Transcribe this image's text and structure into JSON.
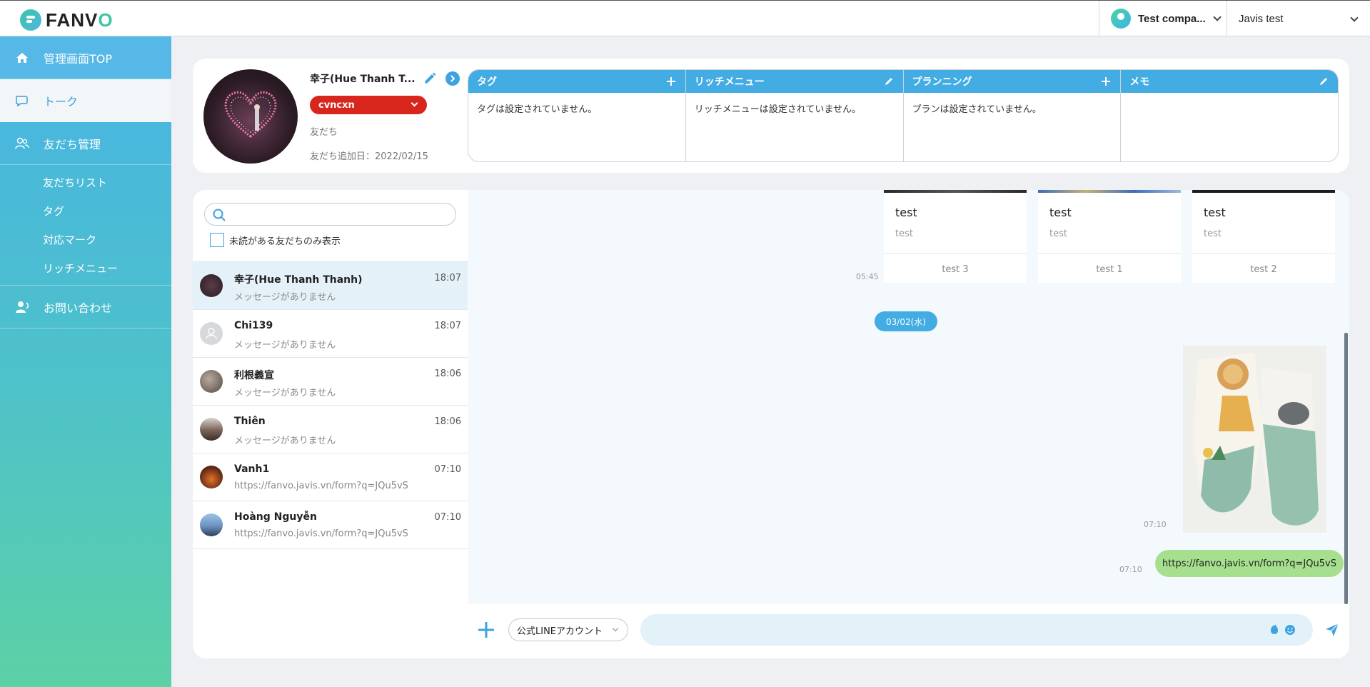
{
  "header": {
    "logo_text_prefix": "FANV",
    "logo_text_o": "O",
    "company_name": "Test compa...",
    "user_name": "Javis test"
  },
  "sidebar": {
    "items": [
      {
        "label": "管理画面TOP",
        "icon": "home-icon"
      },
      {
        "label": "トーク",
        "icon": "chat-icon"
      },
      {
        "label": "友だち管理",
        "icon": "friends-icon"
      },
      {
        "label": "お問い合わせ",
        "icon": "contact-icon"
      }
    ],
    "sub_items": [
      "友だちリスト",
      "タグ",
      "対応マーク",
      "リッチメニュー"
    ]
  },
  "profile": {
    "name": "幸子(Hue Thanh T...",
    "status_value": "cvncxn",
    "friend_label": "友だち",
    "friend_added": "友だち追加日：2022/02/15"
  },
  "panels": [
    {
      "title": "タグ",
      "action_icon": "plus-icon",
      "body": "タグは設定されていません。"
    },
    {
      "title": "リッチメニュー",
      "action_icon": "pencil-icon",
      "body": "リッチメニューは設定されていません。"
    },
    {
      "title": "プランニング",
      "action_icon": "plus-icon",
      "body": "プランは設定されていません。"
    },
    {
      "title": "メモ",
      "action_icon": "pencil-icon",
      "body": ""
    }
  ],
  "friend_list": {
    "search_placeholder": "",
    "unread_only_label": "未読がある友だちのみ表示",
    "rows": [
      {
        "name": "幸子(Hue Thanh Thanh)",
        "time": "18:07",
        "message": "メッセージがありません"
      },
      {
        "name": "Chi139",
        "time": "18:07",
        "message": "メッセージがありません"
      },
      {
        "name": "利根義宣",
        "time": "18:06",
        "message": "メッセージがありません"
      },
      {
        "name": "Thiên",
        "time": "18:06",
        "message": "メッセージがありません"
      },
      {
        "name": "Vanh1",
        "time": "07:10",
        "message": "https://fanvo.javis.vn/form?q=JQu5vS"
      },
      {
        "name": "Hoàng Nguyễn",
        "time": "07:10",
        "message": "https://fanvo.javis.vn/form?q=JQu5vS"
      }
    ]
  },
  "chat": {
    "carousel_time": "05:45",
    "cards": [
      {
        "title": "test",
        "subtitle": "test",
        "action": "test 3"
      },
      {
        "title": "test",
        "subtitle": "test",
        "action": "test 1"
      },
      {
        "title": "test",
        "subtitle": "test",
        "action": "test 2"
      }
    ],
    "date_chip": "03/02(水)",
    "image_time": "07:10",
    "link_time": "07:10",
    "link_text": "https://fanvo.javis.vn/form?q=JQu5vS"
  },
  "composer": {
    "account_select": "公式LINEアカウント",
    "input_value": ""
  },
  "colors": {
    "accent": "#43ace3",
    "status_red": "#d9261c",
    "link_bubble": "#a6e08e"
  }
}
